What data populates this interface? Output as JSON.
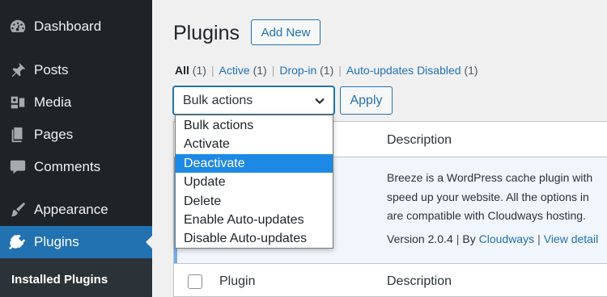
{
  "sidebar": {
    "items": [
      {
        "label": "Dashboard",
        "icon": "dashboard-icon"
      },
      {
        "label": "Posts",
        "icon": "pin-icon"
      },
      {
        "label": "Media",
        "icon": "media-icon"
      },
      {
        "label": "Pages",
        "icon": "pages-icon"
      },
      {
        "label": "Comments",
        "icon": "comments-icon"
      },
      {
        "label": "Appearance",
        "icon": "brush-icon"
      },
      {
        "label": "Plugins",
        "icon": "plugin-icon",
        "active": true
      }
    ],
    "submenu_label": "Installed Plugins"
  },
  "header": {
    "title": "Plugins",
    "add_new_label": "Add New"
  },
  "filters": {
    "all": {
      "label": "All",
      "count": "(1)"
    },
    "active": {
      "label": "Active",
      "count": "(1)"
    },
    "dropin": {
      "label": "Drop-in",
      "count": "(1)"
    },
    "autoupd": {
      "label": "Auto-updates Disabled",
      "count": "(1)"
    },
    "separator": "|"
  },
  "bulk": {
    "selected": "Bulk actions",
    "apply_label": "Apply",
    "options": [
      "Bulk actions",
      "Activate",
      "Deactivate",
      "Update",
      "Delete",
      "Enable Auto-updates",
      "Disable Auto-updates"
    ],
    "highlighted": "Deactivate"
  },
  "table": {
    "col_description": "Description",
    "col_plugin": "Plugin",
    "row": {
      "desc_line1": "Breeze is a WordPress cache plugin with",
      "desc_line2": "speed up your website. All the options in",
      "desc_line3": "are compatible with Cloudways hosting.",
      "version": "Version 2.0.4",
      "by": "By",
      "author": "Cloudways",
      "view_details": "View detail",
      "sep": "|"
    }
  },
  "colors": {
    "sidebar_bg": "#1d2327",
    "accent": "#2271b1",
    "highlight": "#1e88e5",
    "row_active_bg": "#f0f6fc"
  }
}
